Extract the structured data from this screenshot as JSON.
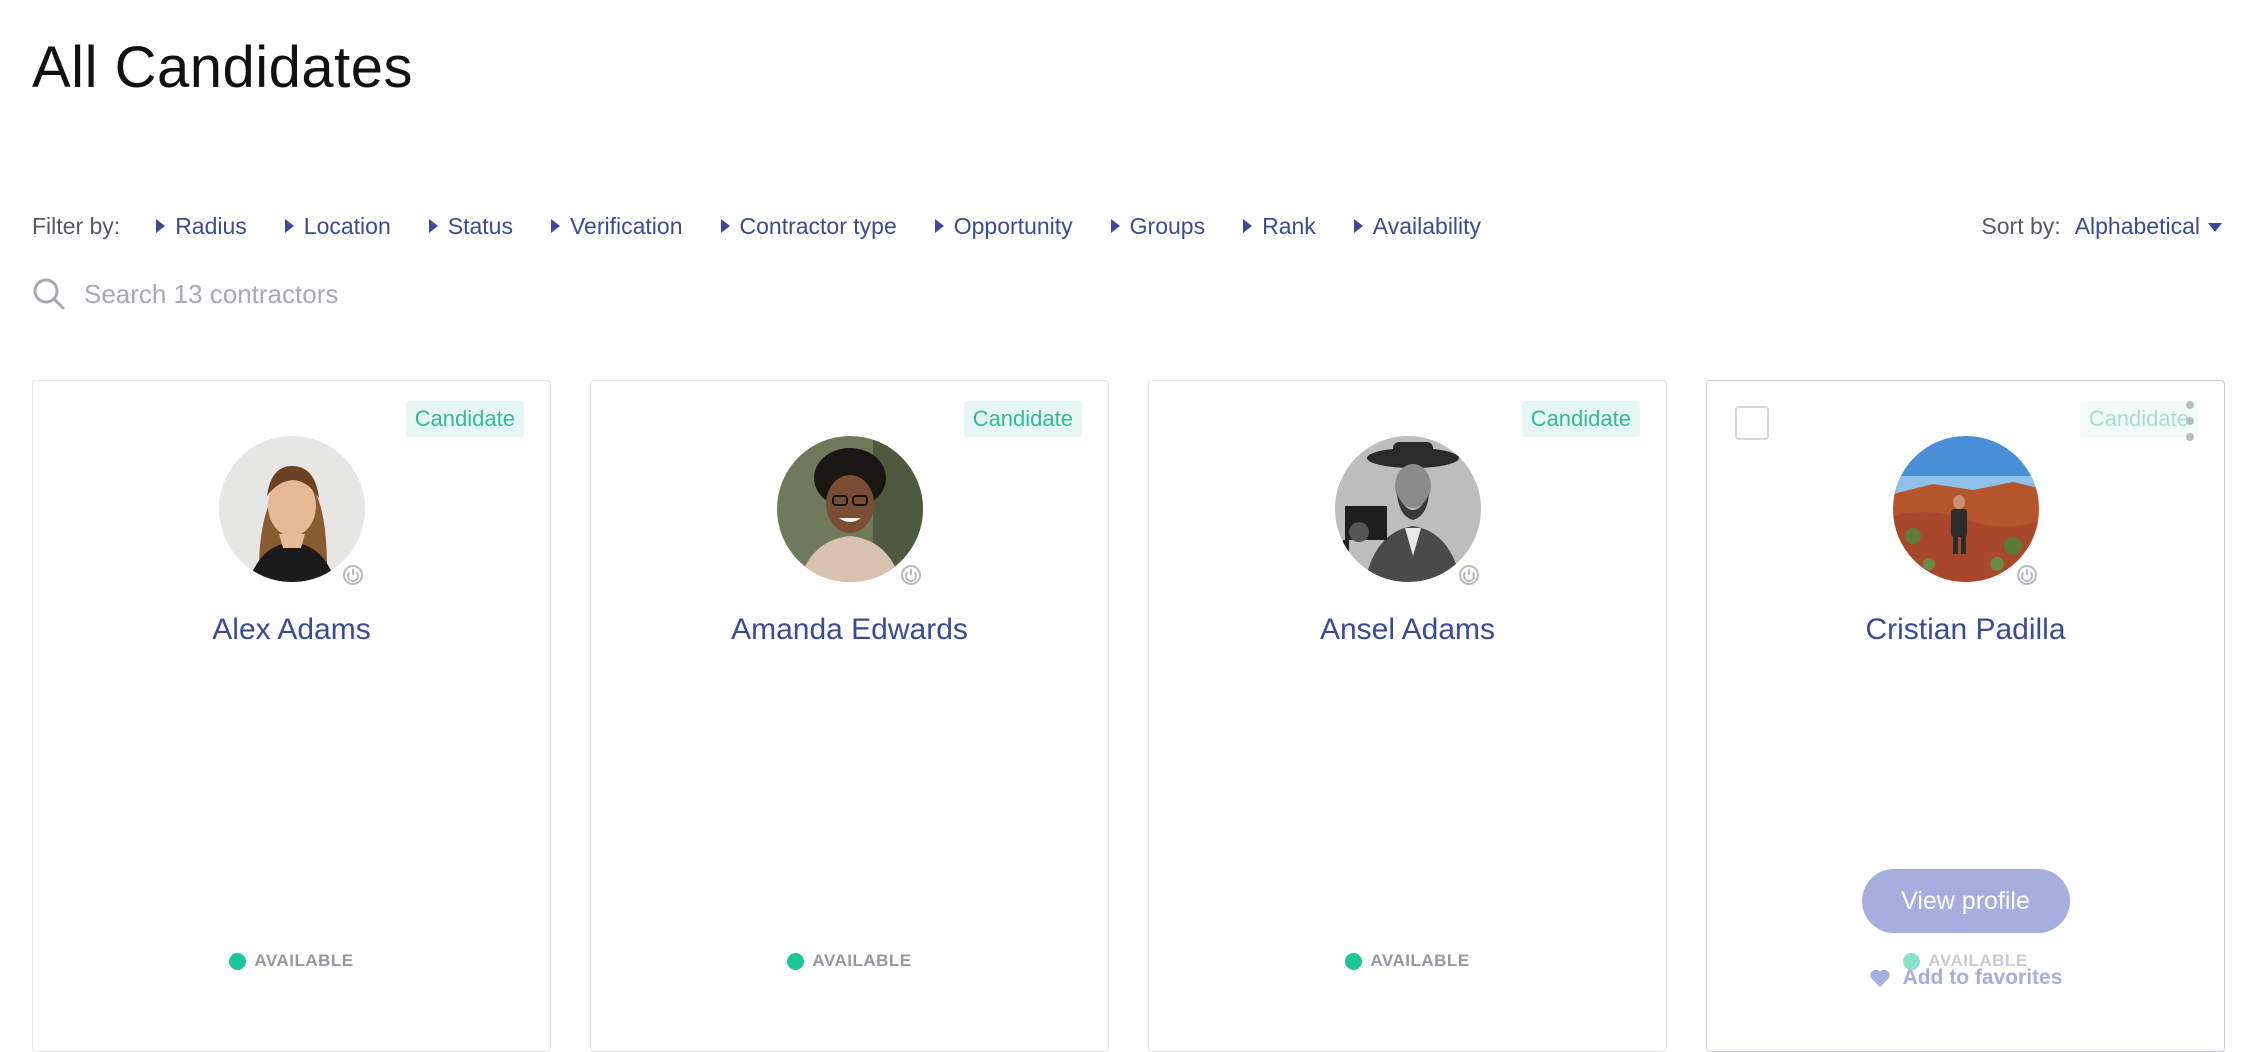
{
  "page": {
    "title": "All Candidates"
  },
  "filters": {
    "label": "Filter by:",
    "items": [
      "Radius",
      "Location",
      "Status",
      "Verification",
      "Contractor type",
      "Opportunity",
      "Groups",
      "Rank",
      "Availability"
    ]
  },
  "sort": {
    "label": "Sort by:",
    "value": "Alphabetical"
  },
  "search": {
    "placeholder": "Search 13 contractors",
    "value": ""
  },
  "colors": {
    "accent": "#3b4a98",
    "tag_text": "#36b89a",
    "tag_bg": "#e6f7f3",
    "available": "#1ac69a",
    "button": "#a6addf"
  },
  "cards": [
    {
      "name": "Alex Adams",
      "tag": "Candidate",
      "status": "AVAILABLE",
      "avatar": "woman-long-hair-photo"
    },
    {
      "name": "Amanda Edwards",
      "tag": "Candidate",
      "status": "AVAILABLE",
      "avatar": "woman-glasses-photo"
    },
    {
      "name": "Ansel Adams",
      "tag": "Candidate",
      "status": "AVAILABLE",
      "avatar": "man-hat-camera-bw-photo"
    },
    {
      "name": "Cristian Padilla",
      "tag": "Candidate",
      "status": "AVAILABLE",
      "avatar": "man-red-rocks-photo",
      "view_label": "View profile",
      "fav_label": "Add to favorites"
    }
  ]
}
